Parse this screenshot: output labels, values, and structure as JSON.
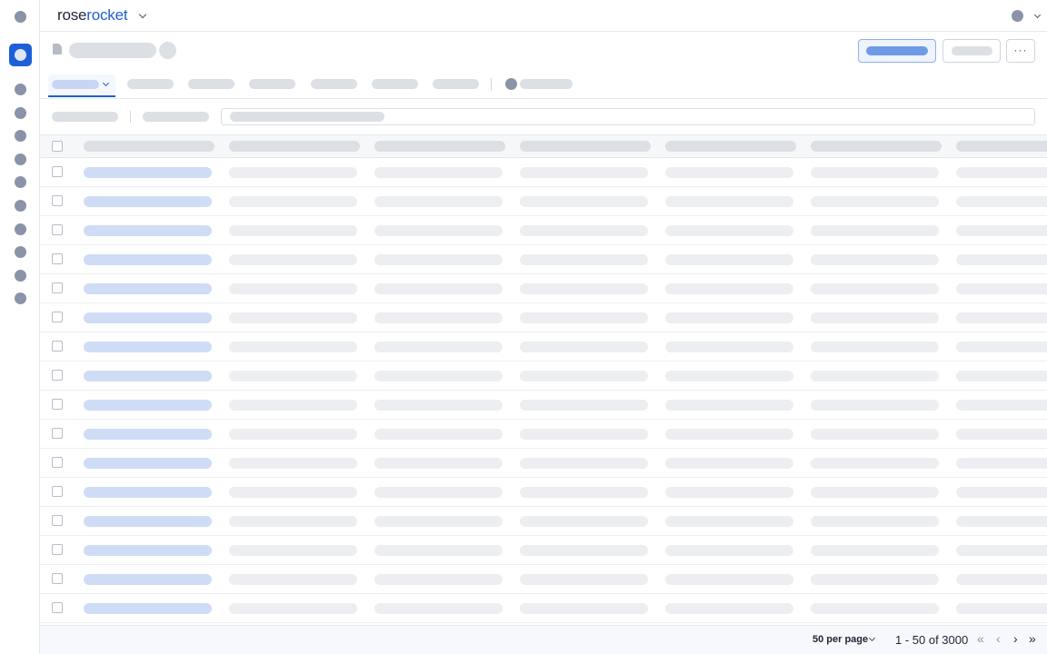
{
  "brand": {
    "name_part1": "rose",
    "name_part2": "rocket"
  },
  "header": {
    "more_label": "···"
  },
  "table": {
    "row_count": 16
  },
  "footer": {
    "per_page": "50 per page",
    "range": "1 - 50 of 3000",
    "first_icon": "«",
    "prev_icon": "‹",
    "next_icon": "›",
    "last_icon": "»"
  },
  "colors": {
    "brand_blue": "#1d5fd6",
    "rail_icon": "#8a93a8",
    "skeleton_gray": "#dcdfe4",
    "skeleton_light": "#eceef1",
    "skeleton_blue": "#cfdcf5"
  },
  "icons": {
    "rail": [
      "app-icon",
      "active-section-icon",
      "nav-icon",
      "nav-icon",
      "nav-icon",
      "nav-icon",
      "nav-icon",
      "nav-icon",
      "nav-icon",
      "nav-icon",
      "nav-icon",
      "nav-icon"
    ],
    "page": "document-icon",
    "user": "user-avatar-icon"
  }
}
